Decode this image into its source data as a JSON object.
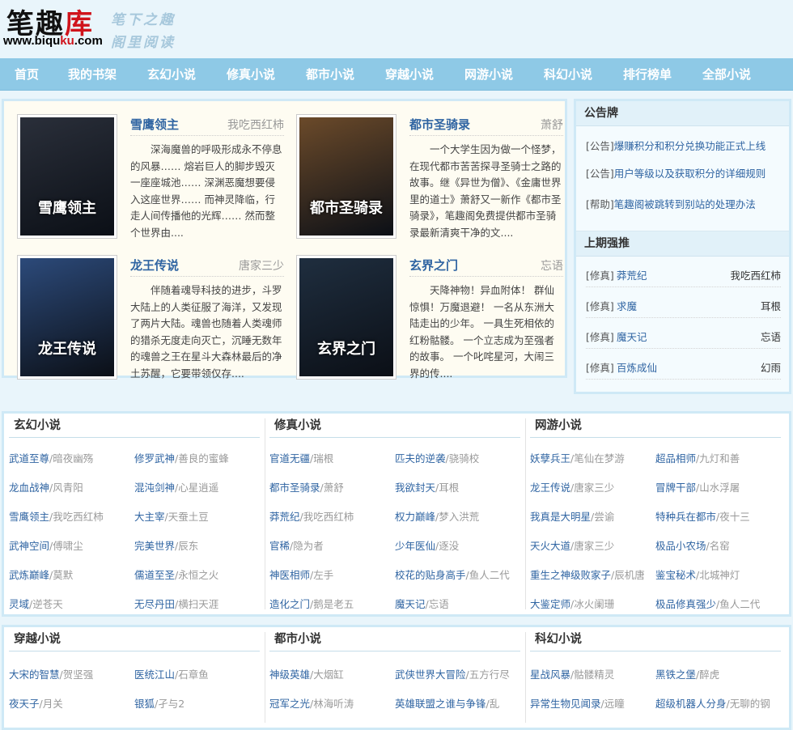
{
  "header": {
    "logo_cn_1": "笔趣",
    "logo_cn_2": "库",
    "logo_url_1": "www.biqu",
    "logo_url_2": "ku",
    "logo_url_3": ".com",
    "slogan_1": "笔下之趣",
    "slogan_2": "阁里阅读"
  },
  "nav": [
    "首页",
    "我的书架",
    "玄幻小说",
    "修真小说",
    "都市小说",
    "穿越小说",
    "网游小说",
    "科幻小说",
    "排行榜单",
    "全部小说"
  ],
  "featured": [
    {
      "title": "雪鹰领主",
      "author": "我吃西红柿",
      "desc": "深海魔兽的呼吸形成永不停息的风暴…… 熔岩巨人的脚步毁灭一座座城池…… 深渊恶魔想要侵入这座世界…… 而神灵降临，行走人间传播他的光辉…… 然而整个世界由....",
      "cover_text": "雪鹰领主",
      "cover_color": "#2a2f3a"
    },
    {
      "title": "都市圣骑录",
      "author": "萧舒",
      "desc": "一个大学生因为做一个怪梦，在现代都市苦苦探寻圣骑士之路的故事。继《异世为僧》、《金庸世界里的道士》萧舒又一新作《都市圣骑录》，笔趣阁免费提供都市圣骑录最新清爽干净的文....",
      "cover_text": "都市圣骑录",
      "cover_color": "#6b4a2a"
    },
    {
      "title": "龙王传说",
      "author": "唐家三少",
      "desc": "伴随着魂导科技的进步，斗罗大陆上的人类征服了海洋，又发现了两片大陆。魂兽也随着人类魂师的猎杀无度走向灭亡，沉睡无数年的魂兽之王在星斗大森林最后的净土苏醒，它要带领仅存....",
      "cover_text": "龙王传说",
      "cover_color": "#2c4a7a"
    },
    {
      "title": "玄界之门",
      "author": "忘语",
      "desc": "天降神物！异血附体！ 群仙惊惧！万魔退避！ 一名从东洲大陆走出的少年。 一具生死相依的红粉骷髅。 一个立志成为至强者的故事。 一个叱咤星河，大闹三界的传....",
      "cover_text": "玄界之门",
      "cover_color": "#1f2e3f"
    }
  ],
  "notice": {
    "title": "公告牌",
    "items": [
      {
        "tag": "[公告]",
        "text": "爆赚积分和积分兑换功能正式上线"
      },
      {
        "tag": "[公告]",
        "text": "用户等级以及获取积分的详细规则"
      },
      {
        "tag": "[帮助]",
        "text": "笔趣阁被跳转到别站的处理办法"
      }
    ]
  },
  "last": {
    "title": "上期强推",
    "items": [
      {
        "tag": "[修真]",
        "name": "莽荒纪",
        "author": "我吃西红柿"
      },
      {
        "tag": "[修真]",
        "name": "求魔",
        "author": "耳根"
      },
      {
        "tag": "[修真]",
        "name": "魔天记",
        "author": "忘语"
      },
      {
        "tag": "[修真]",
        "name": "百炼成仙",
        "author": "幻雨"
      }
    ]
  },
  "cats_row1": [
    {
      "title": "玄幻小说",
      "items": [
        [
          "武道至尊",
          "暗夜幽殇"
        ],
        [
          "修罗武神",
          "善良的蜜蜂"
        ],
        [
          "龙血战神",
          "风青阳"
        ],
        [
          "混沌剑神",
          "心星逍遥"
        ],
        [
          "雪鹰领主",
          "我吃西红柿"
        ],
        [
          "大主宰",
          "天蚕土豆"
        ],
        [
          "武神空间",
          "傅啸尘"
        ],
        [
          "完美世界",
          "辰东"
        ],
        [
          "武炼巅峰",
          "莫默"
        ],
        [
          "儒道至圣",
          "永恒之火"
        ],
        [
          "灵域",
          "逆苍天"
        ],
        [
          "无尽丹田",
          "横扫天涯"
        ]
      ]
    },
    {
      "title": "修真小说",
      "items": [
        [
          "官道无疆",
          "瑞根"
        ],
        [
          "匹夫的逆袭",
          "骁骑校"
        ],
        [
          "都市圣骑录",
          "萧舒"
        ],
        [
          "我欲封天",
          "耳根"
        ],
        [
          "莽荒纪",
          "我吃西红柿"
        ],
        [
          "权力巅峰",
          "梦入洪荒"
        ],
        [
          "官稀",
          "隐为者"
        ],
        [
          "少年医仙",
          "逐没"
        ],
        [
          "神医相师",
          "左手"
        ],
        [
          "校花的贴身高手",
          "鱼人二代"
        ],
        [
          "造化之门",
          "鹅是老五"
        ],
        [
          "魔天记",
          "忘语"
        ]
      ]
    },
    {
      "title": "网游小说",
      "items": [
        [
          "妖孽兵王",
          "笔仙在梦游"
        ],
        [
          "超品相师",
          "九灯和善"
        ],
        [
          "龙王传说",
          "唐家三少"
        ],
        [
          "冒牌干部",
          "山水浮屠"
        ],
        [
          "我真是大明星",
          "尝谕"
        ],
        [
          "特种兵在都市",
          "夜十三"
        ],
        [
          "天火大道",
          "唐家三少"
        ],
        [
          "极品小农场",
          "名窑"
        ],
        [
          "重生之神级败家子",
          "辰机唐"
        ],
        [
          "鉴宝秘术",
          "北城神灯"
        ],
        [
          "大鉴定师",
          "冰火阑珊"
        ],
        [
          "极品修真强少",
          "鱼人二代"
        ]
      ]
    }
  ],
  "cats_row2": [
    {
      "title": "穿越小说",
      "items": [
        [
          "大宋的智慧",
          "贺坚强"
        ],
        [
          "医统江山",
          "石章鱼"
        ],
        [
          "夜天子",
          "月关"
        ],
        [
          "银狐",
          "孑与2"
        ]
      ]
    },
    {
      "title": "都市小说",
      "items": [
        [
          "神级英雄",
          "大烟缸"
        ],
        [
          "武侠世界大冒险",
          "五方行尽"
        ],
        [
          "冠军之光",
          "林海听涛"
        ],
        [
          "英雄联盟之谁与争锋",
          "乱"
        ]
      ]
    },
    {
      "title": "科幻小说",
      "items": [
        [
          "星战风暴",
          "骷髅精灵"
        ],
        [
          "黑铁之堡",
          "醉虎"
        ],
        [
          "异常生物见闻录",
          "远瞳"
        ],
        [
          "超级机器人分身",
          "无聊的钢"
        ]
      ]
    }
  ],
  "colors": {
    "nav_bg": "#8ec9e6",
    "link": "#2f64a2",
    "border": "#cfe9f6",
    "logo_red": "#d0141c"
  }
}
